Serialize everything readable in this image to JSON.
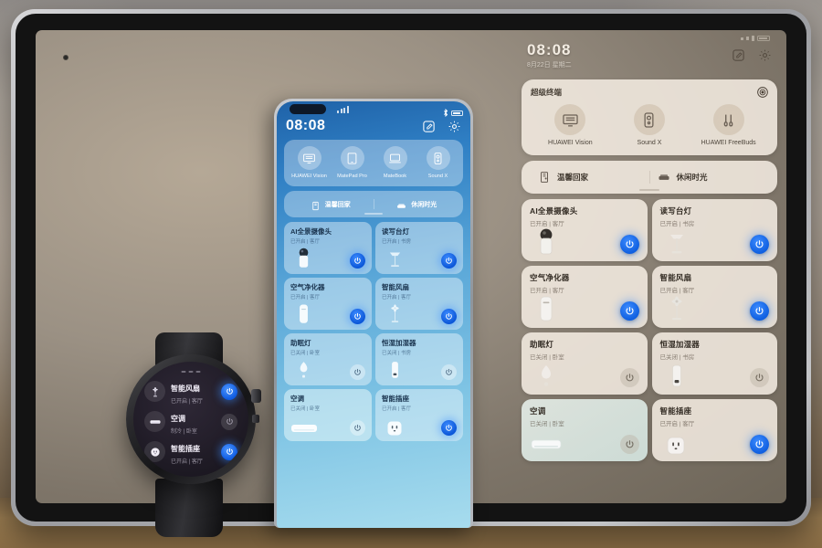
{
  "tablet": {
    "status_time": "08:08",
    "status_date": "8月22日 星期二",
    "header": {
      "edit_icon": "edit-square-icon",
      "settings_icon": "gear-icon"
    },
    "super_device": {
      "title": "超级终端",
      "target_icon": "target-icon",
      "devices": [
        {
          "label": "HUAWEI Vision",
          "icon": "tv-icon"
        },
        {
          "label": "Sound X",
          "icon": "speaker-icon"
        },
        {
          "label": "HUAWEI FreeBuds",
          "icon": "earbuds-icon"
        }
      ]
    },
    "scenes": [
      {
        "label": "温馨回家",
        "icon": "door-icon"
      },
      {
        "label": "休闲时光",
        "icon": "sofa-icon"
      }
    ],
    "devices": [
      {
        "name": "AI全景摄像头",
        "sub": "已开启 | 客厅",
        "power": "on",
        "icon": "camera-icon",
        "theme": "warm"
      },
      {
        "name": "读写台灯",
        "sub": "已开启 | 书房",
        "power": "on",
        "icon": "desklamp-icon",
        "theme": "warm"
      },
      {
        "name": "空气净化器",
        "sub": "已开启 | 客厅",
        "power": "on",
        "icon": "purifier-icon",
        "theme": "warm"
      },
      {
        "name": "智能风扇",
        "sub": "已开启 | 客厅",
        "power": "on",
        "icon": "fan-icon",
        "theme": "warm"
      },
      {
        "name": "助眠灯",
        "sub": "已关闭 | 卧室",
        "power": "off",
        "icon": "sleeplamp-icon",
        "theme": "warm"
      },
      {
        "name": "恒湿加湿器",
        "sub": "已关闭 | 书房",
        "power": "off",
        "icon": "humidifier-icon",
        "theme": "warm"
      },
      {
        "name": "空调",
        "sub": "已关闭 | 卧室",
        "power": "off",
        "icon": "ac-icon",
        "theme": "cool"
      },
      {
        "name": "智能插座",
        "sub": "已开启 | 客厅",
        "power": "on",
        "icon": "socket-icon",
        "theme": "warm"
      }
    ]
  },
  "phone": {
    "status_time": "08:08",
    "header": {
      "edit_icon": "edit-square-icon",
      "settings_icon": "gear-icon"
    },
    "super_device": {
      "devices": [
        {
          "label": "HUAWEI Vision",
          "icon": "tv-icon"
        },
        {
          "label": "MatePad Pro",
          "icon": "tablet-icon"
        },
        {
          "label": "MateBook",
          "icon": "laptop-icon"
        },
        {
          "label": "Sound X",
          "icon": "speaker-icon"
        }
      ]
    },
    "scenes": [
      {
        "label": "温馨回家",
        "icon": "door-icon"
      },
      {
        "label": "休闲时光",
        "icon": "sofa-icon"
      }
    ],
    "devices": [
      {
        "name": "AI全景摄像头",
        "sub": "已开启 | 客厅",
        "power": "on",
        "icon": "camera-icon",
        "theme": "warm"
      },
      {
        "name": "读写台灯",
        "sub": "已开启 | 书房",
        "power": "on",
        "icon": "desklamp-icon",
        "theme": "warm"
      },
      {
        "name": "空气净化器",
        "sub": "已开启 | 客厅",
        "power": "on",
        "icon": "purifier-icon",
        "theme": "warm"
      },
      {
        "name": "智能风扇",
        "sub": "已开启 | 客厅",
        "power": "on",
        "icon": "fan-icon",
        "theme": "warm"
      },
      {
        "name": "助眠灯",
        "sub": "已关闭 | 卧室",
        "power": "off",
        "icon": "sleeplamp-icon",
        "theme": "warm"
      },
      {
        "name": "恒湿加湿器",
        "sub": "已关闭 | 书房",
        "power": "off",
        "icon": "humidifier-icon",
        "theme": "warm"
      },
      {
        "name": "空调",
        "sub": "已关闭 | 卧室",
        "power": "off",
        "icon": "ac-icon",
        "theme": "cool"
      },
      {
        "name": "智能插座",
        "sub": "已开启 | 客厅",
        "power": "on",
        "icon": "socket-icon",
        "theme": "warm"
      }
    ]
  },
  "watch": {
    "devices": [
      {
        "name": "智能风扇",
        "sub": "已开启 | 客厅",
        "power": "on",
        "icon": "fan-icon"
      },
      {
        "name": "空调",
        "sub": "制冷 | 卧室",
        "power": "off",
        "icon": "ac-icon"
      },
      {
        "name": "智能插座",
        "sub": "已开启 | 客厅",
        "power": "on",
        "icon": "socket-icon"
      }
    ]
  },
  "colors": {
    "accent_on": "#1a6ef0",
    "tablet_card": "#f3ebe0",
    "phone_gradient_top": "#1f62a8",
    "phone_gradient_bottom": "#a7dcee"
  }
}
